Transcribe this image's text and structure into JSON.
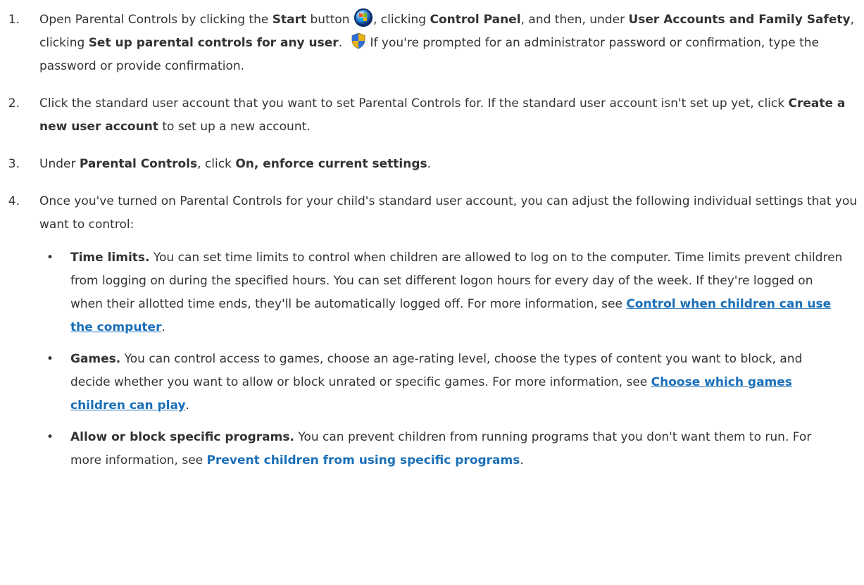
{
  "steps": [
    {
      "number": "1.",
      "t1": "Open Parental Controls by clicking the ",
      "b1": "Start",
      "t2": " button ",
      "t3": ", clicking ",
      "b2": "Control Panel",
      "t4": ", and then, under ",
      "b3": "User Accounts and Family Safety",
      "t5": ", clicking ",
      "b4": "Set up parental controls for any user",
      "t6": ". ",
      "t7": "If you're prompted for an administrator password or confirmation, type the password or provide confirmation."
    },
    {
      "number": "2.",
      "t1": "Click the standard user account that you want to set Parental Controls for. If the standard user account isn't set up yet, click ",
      "b1": "Create a new user account",
      "t2": " to set up a new account."
    },
    {
      "number": "3.",
      "t1": "Under ",
      "b1": "Parental Controls",
      "t2": ", click ",
      "b2": "On, enforce current settings",
      "t3": "."
    },
    {
      "number": "4.",
      "t1": "Once you've turned on Parental Controls for your child's standard user account, you can adjust the following individual settings that you want to control:"
    }
  ],
  "bullets": [
    {
      "dot": "•",
      "title": "Time limits.",
      "text": " You can set time limits to control when children are allowed to log on to the computer. Time limits prevent children from logging on during the specified hours. You can set different logon hours for every day of the week. If they're logged on when their allotted time ends, they'll be automatically logged off. For more information, see ",
      "link": "Control when children can use the computer",
      "end": "."
    },
    {
      "dot": "•",
      "title": "Games.",
      "text": " You can control access to games, choose an age-rating level, choose the types of content you want to block, and decide whether you want to allow or block unrated or specific games. For more information, see ",
      "link": "Choose which games children can play",
      "end": "."
    },
    {
      "dot": "•",
      "title": "Allow or block specific programs.",
      "text": " You can prevent children from running programs that you don't want them to run. For more information, see ",
      "link": "Prevent children from using specific programs",
      "end": "."
    }
  ],
  "icons": {
    "start": "windows-start-orb-icon",
    "uac": "uac-shield-icon"
  },
  "colors": {
    "link": "#1a6fb8",
    "text": "#333333"
  }
}
